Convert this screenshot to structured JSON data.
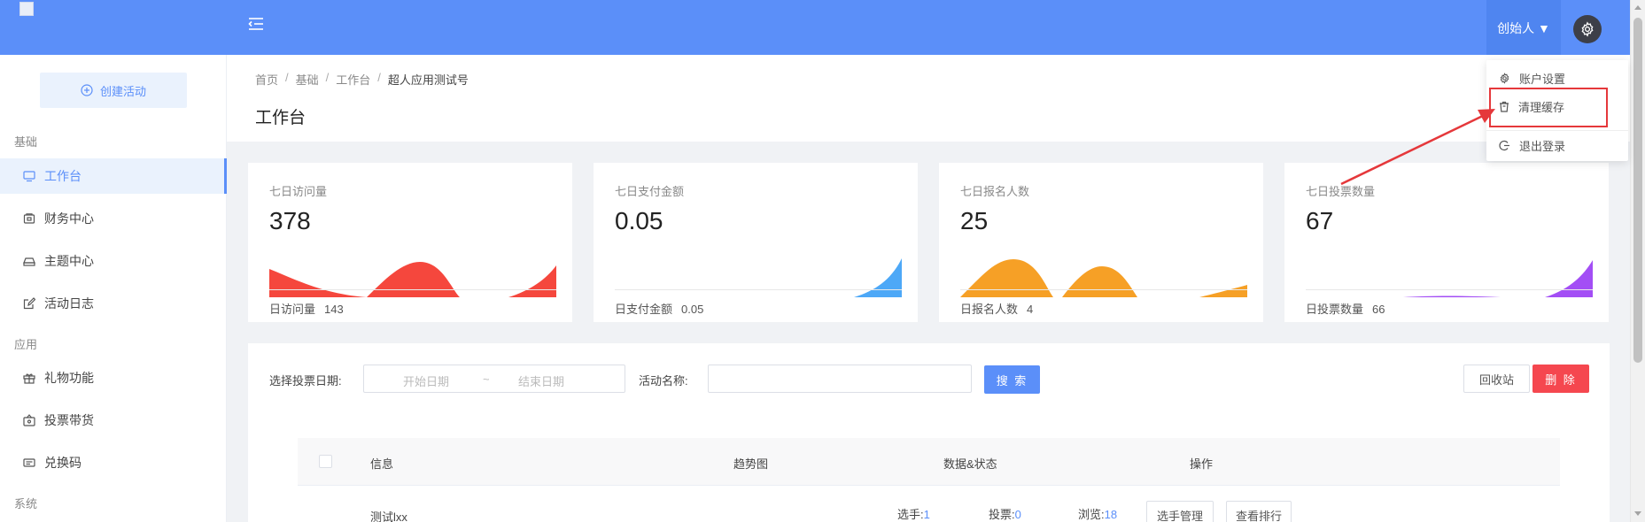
{
  "header": {
    "user_label": "创始人 ▼"
  },
  "sidebar": {
    "create_label": "创建活动",
    "groups": [
      {
        "label": "基础"
      },
      {
        "label": "应用"
      },
      {
        "label": "系统"
      }
    ],
    "items": [
      {
        "label": "工作台",
        "icon": "monitor-icon",
        "active": true
      },
      {
        "label": "财务中心",
        "icon": "wallet-icon"
      },
      {
        "label": "主题中心",
        "icon": "layers-icon"
      },
      {
        "label": "活动日志",
        "icon": "edit-icon"
      },
      {
        "label": "礼物功能",
        "icon": "gift-icon"
      },
      {
        "label": "投票带货",
        "icon": "vote-icon"
      },
      {
        "label": "兑换码",
        "icon": "ticket-icon"
      }
    ]
  },
  "breadcrumb": [
    "首页",
    "基础",
    "工作台",
    "超人应用测试号"
  ],
  "page_title": "工作台",
  "stats": [
    {
      "label": "七日访问量",
      "value": "378",
      "foot_label": "日访问量",
      "foot_value": "143",
      "color": "#f5473d"
    },
    {
      "label": "七日支付金额",
      "value": "0.05",
      "foot_label": "日支付金额",
      "foot_value": "0.05",
      "color": "#4da8f7"
    },
    {
      "label": "七日报名人数",
      "value": "25",
      "foot_label": "日报名人数",
      "foot_value": "4",
      "color": "#f6a026"
    },
    {
      "label": "七日投票数量",
      "value": "67",
      "foot_label": "日投票数量",
      "foot_value": "66",
      "color": "#a34ef5"
    }
  ],
  "filters": {
    "date_label": "选择投票日期:",
    "start_placeholder": "开始日期",
    "range_sep": "~",
    "end_placeholder": "结束日期",
    "name_label": "活动名称:",
    "name_value": "",
    "search_label": "搜 索",
    "recycle_label": "回收站",
    "delete_label": "删 除"
  },
  "table": {
    "headers": [
      "信息",
      "趋势图",
      "数据&状态",
      "操作"
    ],
    "rows": [
      {
        "name": "测试lxx",
        "players_label": "选手:",
        "players": "1",
        "votes_label": "投票:",
        "votes": "0",
        "views_label": "浏览:",
        "views": "18",
        "btn_manage": "选手管理",
        "btn_rank": "查看排行"
      }
    ]
  },
  "dropdown": {
    "items": [
      {
        "label": "账户设置",
        "icon": "gear-icon"
      },
      {
        "label": "清理缓存",
        "icon": "trash-icon"
      },
      {
        "label": "退出登录",
        "icon": "logout-icon"
      }
    ]
  },
  "colors": {
    "primary": "#5b8ff9",
    "danger": "#f5474f",
    "annotation": "#e5383b"
  }
}
